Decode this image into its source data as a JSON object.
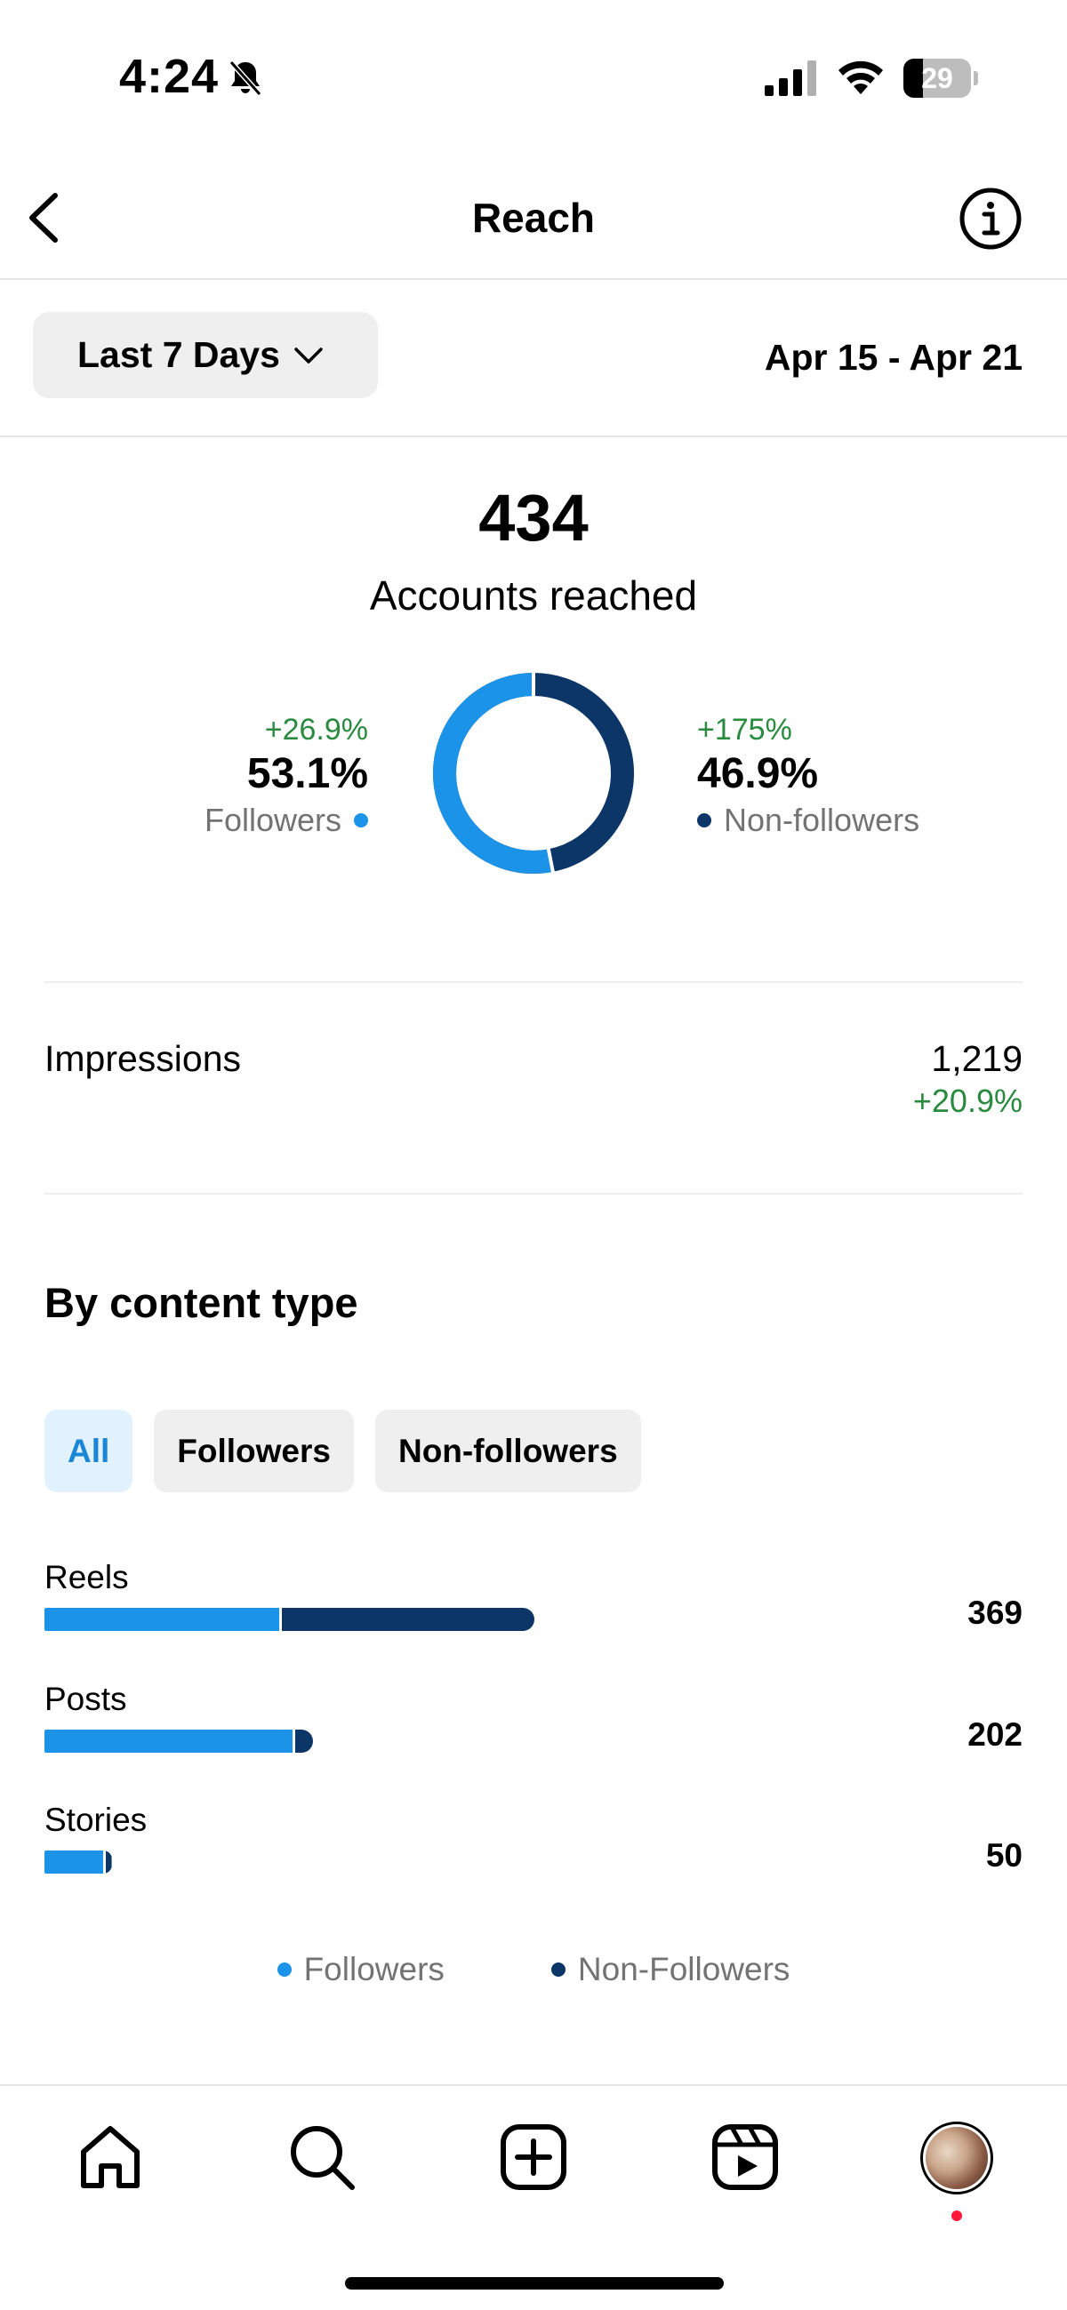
{
  "status_bar": {
    "time": "4:24",
    "battery": "29",
    "battery_level": 0.29
  },
  "header": {
    "title": "Reach"
  },
  "range": {
    "selected": "Last 7 Days",
    "dates": "Apr 15 - Apr 21"
  },
  "summary": {
    "count": "434",
    "label": "Accounts reached",
    "followers": {
      "change": "+26.9%",
      "percent": "53.1%",
      "label": "Followers",
      "share": 53.1
    },
    "non_followers": {
      "change": "+175%",
      "percent": "46.9%",
      "label": "Non-followers",
      "share": 46.9
    }
  },
  "impressions": {
    "label": "Impressions",
    "value": "1,219",
    "change": "+20.9%"
  },
  "content_type": {
    "title": "By content type",
    "chips": [
      "All",
      "Followers",
      "Non-followers"
    ],
    "selected_chip": "All",
    "rows": [
      {
        "label": "Reels",
        "value": "369",
        "total": 369,
        "followers": 177,
        "non_followers": 192
      },
      {
        "label": "Posts",
        "value": "202",
        "total": 202,
        "followers": 187,
        "non_followers": 15
      },
      {
        "label": "Stories",
        "value": "50",
        "total": 50,
        "followers": 44,
        "non_followers": 6
      }
    ],
    "legend": [
      "Followers",
      "Non-Followers"
    ]
  },
  "colors": {
    "followers": "#1a93e8",
    "non_followers": "#0c3668",
    "positive": "#2a8a3f",
    "chip_active_bg": "#e1f1fd",
    "chip_active_text": "#1a86d8"
  },
  "tab_bar": {
    "icons": [
      "home-icon",
      "search-icon",
      "create-icon",
      "reels-icon",
      "profile-avatar"
    ]
  }
}
